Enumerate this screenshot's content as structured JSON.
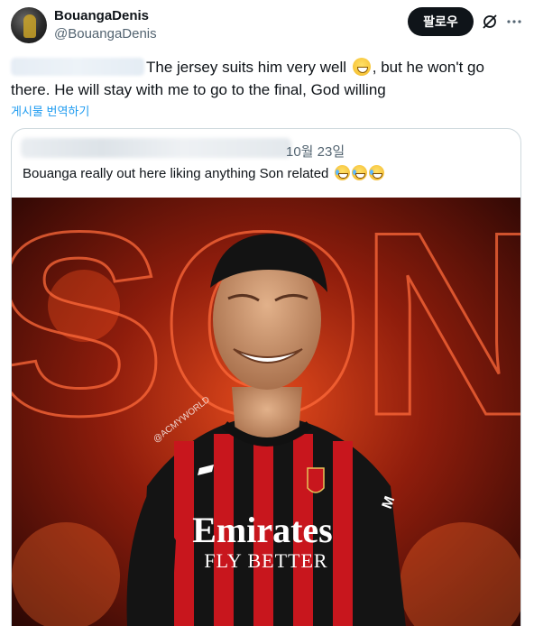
{
  "author": {
    "display_name": "BouangaDenis",
    "handle": "@BouangaDenis",
    "avatar_icon": "avatar-photo"
  },
  "header": {
    "follow_label": "팔로우",
    "grok_icon": "grok-icon",
    "more_icon": "more-icon"
  },
  "tweet": {
    "text_line": "The jersey suits him very well",
    "emoji": "grinning-face",
    "text_rest": ", but he won't go there. He will stay with me to go to the final, God willing",
    "translate_label": "게시물 번역하기"
  },
  "quote": {
    "date": "10월 23일",
    "text": "Bouanga really out here liking anything Son related",
    "emojis": [
      "face-with-tears-of-joy",
      "face-with-tears-of-joy",
      "face-with-tears-of-joy"
    ]
  },
  "media": {
    "background_text": "SON",
    "watermark": "@ACMYWORLD",
    "shirt_sponsor": "Emirates",
    "shirt_tagline": "FLY BETTER",
    "colors": {
      "red": "#c8161d",
      "black": "#111111",
      "fire": "#ff5a1f"
    }
  }
}
